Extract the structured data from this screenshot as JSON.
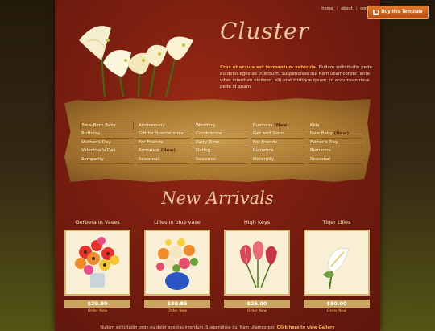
{
  "topnav": {
    "items": [
      "home",
      "about",
      "contact"
    ]
  },
  "buy_button": {
    "label": "Buy this Template"
  },
  "logo": {
    "text": "Cluster"
  },
  "intro": {
    "lead": "Cras et arcu a est fermentum vehicula.",
    "body": "Nullam sollicitudin pede eu dolor egestas interdum. Suspendisse dui Nam ullamcorper, ante vitae interdum eleifend, elit erat tristique ipsum, in accumsan risus pede id quam."
  },
  "categories": {
    "columns": [
      [
        {
          "label": "New Born Baby"
        },
        {
          "label": "Birthday"
        },
        {
          "label": "Mother's Day"
        },
        {
          "label": "Valentine's Day"
        },
        {
          "label": "Sympathy"
        }
      ],
      [
        {
          "label": "Anniversary"
        },
        {
          "label": "Gift for Special ones"
        },
        {
          "label": "For Friends"
        },
        {
          "label": "Romance",
          "tag": "(New)"
        },
        {
          "label": "Seasonal"
        }
      ],
      [
        {
          "label": "Wedding"
        },
        {
          "label": "Condolence"
        },
        {
          "label": "Party Time"
        },
        {
          "label": "Dating"
        },
        {
          "label": "Seasonal"
        }
      ],
      [
        {
          "label": "Business",
          "tag": "(New)"
        },
        {
          "label": "Get well Soon"
        },
        {
          "label": "For Friends"
        },
        {
          "label": "Romance"
        },
        {
          "label": "Maternity"
        }
      ],
      [
        {
          "label": "Kids"
        },
        {
          "label": "New Baby",
          "tag": "(New)"
        },
        {
          "label": "Father's Day"
        },
        {
          "label": "Romance"
        },
        {
          "label": "Seasonal"
        }
      ]
    ]
  },
  "new_arrivals": {
    "title": "New Arrivals",
    "products": [
      {
        "name": "Gerbera in Vases",
        "price": "$29.99",
        "order": "Order Now"
      },
      {
        "name": "Lilies in blue vase",
        "price": "$30.85",
        "order": "Order Now"
      },
      {
        "name": "High Keys",
        "price": "$25.00",
        "order": "Order Now"
      },
      {
        "name": "Tiger Lilies",
        "price": "$50.00",
        "order": "Order Now"
      }
    ]
  },
  "footer": {
    "text": "Nullam sollicitudin pede eu dolor egestas interdum. Suspendisse dui Nam ullamcorper.",
    "link": "Click here to view Gallery"
  },
  "colors": {
    "accent": "#f2b34a",
    "page_red": "#7d1f10",
    "board_gold": "#c79a4d"
  }
}
